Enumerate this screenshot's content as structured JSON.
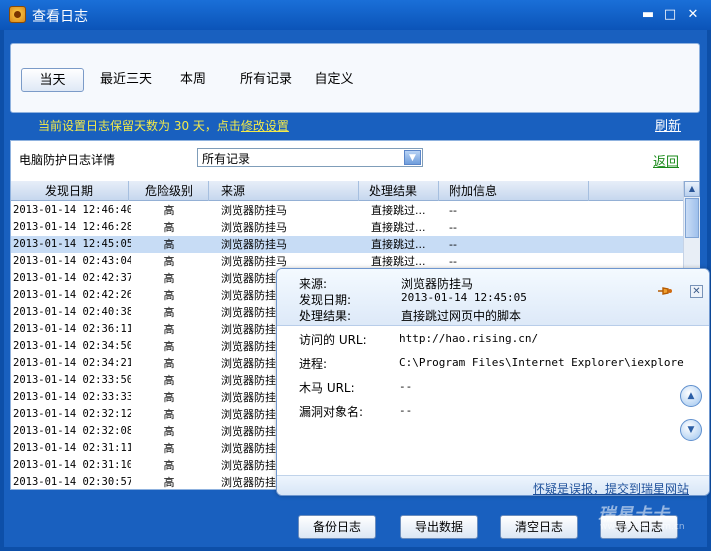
{
  "window": {
    "title": "查看日志"
  },
  "tabs": [
    {
      "label": "当天",
      "active": true
    },
    {
      "label": "最近三天",
      "active": false
    },
    {
      "label": "本周",
      "active": false
    },
    {
      "label": "所有记录",
      "active": false
    },
    {
      "label": "自定义",
      "active": false
    }
  ],
  "info": {
    "prefix": "当前设置日志保留天数为 30 天，点击",
    "link": "修改设置"
  },
  "refresh_label": "刷新",
  "panel": {
    "label": "电脑防护日志详情",
    "filter_value": "所有记录",
    "back_label": "返回"
  },
  "table": {
    "columns": [
      "发现日期",
      "危险级别",
      "来源",
      "处理结果",
      "附加信息"
    ],
    "rows": [
      {
        "date": "2013-01-14 12:46:40",
        "level": "高",
        "source": "浏览器防挂马",
        "result": "直接跳过...",
        "extra": "--"
      },
      {
        "date": "2013-01-14 12:46:28",
        "level": "高",
        "source": "浏览器防挂马",
        "result": "直接跳过...",
        "extra": "--"
      },
      {
        "date": "2013-01-14 12:45:05",
        "level": "高",
        "source": "浏览器防挂马",
        "result": "直接跳过...",
        "extra": "--"
      },
      {
        "date": "2013-01-14 02:43:04",
        "level": "高",
        "source": "浏览器防挂马",
        "result": "直接跳过...",
        "extra": "--"
      },
      {
        "date": "2013-01-14 02:42:37",
        "level": "高",
        "source": "浏览器防挂",
        "result": "",
        "extra": ""
      },
      {
        "date": "2013-01-14 02:42:26",
        "level": "高",
        "source": "浏览器防挂",
        "result": "",
        "extra": ""
      },
      {
        "date": "2013-01-14 02:40:38",
        "level": "高",
        "source": "浏览器防挂",
        "result": "",
        "extra": ""
      },
      {
        "date": "2013-01-14 02:36:11",
        "level": "高",
        "source": "浏览器防挂",
        "result": "",
        "extra": ""
      },
      {
        "date": "2013-01-14 02:34:50",
        "level": "高",
        "source": "浏览器防挂",
        "result": "",
        "extra": ""
      },
      {
        "date": "2013-01-14 02:34:21",
        "level": "高",
        "source": "浏览器防挂",
        "result": "",
        "extra": ""
      },
      {
        "date": "2013-01-14 02:33:50",
        "level": "高",
        "source": "浏览器防挂",
        "result": "",
        "extra": ""
      },
      {
        "date": "2013-01-14 02:33:33",
        "level": "高",
        "source": "浏览器防挂",
        "result": "",
        "extra": ""
      },
      {
        "date": "2013-01-14 02:32:12",
        "level": "高",
        "source": "浏览器防挂",
        "result": "",
        "extra": ""
      },
      {
        "date": "2013-01-14 02:32:08",
        "level": "高",
        "source": "浏览器防挂",
        "result": "",
        "extra": ""
      },
      {
        "date": "2013-01-14 02:31:11",
        "level": "高",
        "source": "浏览器防挂",
        "result": "",
        "extra": ""
      },
      {
        "date": "2013-01-14 02:31:10",
        "level": "高",
        "source": "浏览器防挂",
        "result": "",
        "extra": ""
      },
      {
        "date": "2013-01-14 02:30:57",
        "level": "高",
        "source": "浏览器防挂",
        "result": "",
        "extra": ""
      }
    ],
    "selected_index": 2
  },
  "popup": {
    "header": [
      {
        "label": "来源:",
        "value": "浏览器防挂马"
      },
      {
        "label": "发现日期:",
        "value": "2013-01-14 12:45:05"
      },
      {
        "label": "处理结果:",
        "value": "直接跳过网页中的脚本"
      }
    ],
    "details": [
      {
        "label": "访问的 URL:",
        "value": "http://hao.rising.cn/"
      },
      {
        "label": "进程:",
        "value": "C:\\Program Files\\Internet Explorer\\iexplore"
      },
      {
        "label": "木马 URL:",
        "value": "--"
      },
      {
        "label": "漏洞对象名:",
        "value": "--"
      }
    ],
    "report_link": "怀疑是误报，提交到瑞星网站"
  },
  "buttons": {
    "backup": "备份日志",
    "export": "导出数据",
    "clear": "清空日志",
    "import": "导入日志"
  },
  "watermark": {
    "brand": "瑞星卡卡",
    "sub": "www.rising.com.cn"
  },
  "colors": {
    "titlebar": "#0b54b8",
    "client_bg": "#1960bf",
    "info_text": "#f3ea4a",
    "selected_row": "#c7dcf5",
    "back_link": "#1a8a1a"
  }
}
